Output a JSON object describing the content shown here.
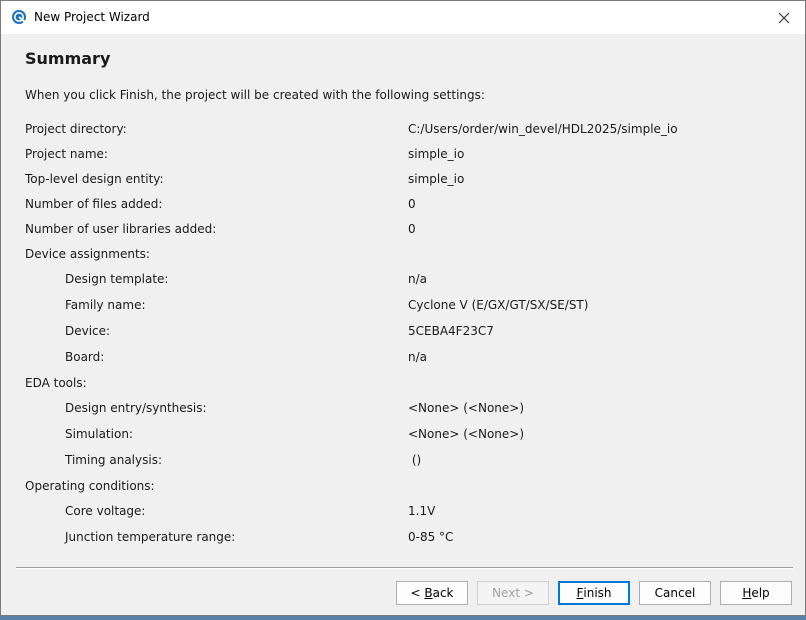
{
  "window": {
    "title": "New Project Wizard"
  },
  "page": {
    "heading": "Summary",
    "intro": "When you click Finish, the project will be created with the following settings:"
  },
  "settings": [
    {
      "label": "Project directory:",
      "value": "C:/Users/order/win_devel/HDL2025/simple_io",
      "level": 0
    },
    {
      "label": "Project name:",
      "value": "simple_io",
      "level": 0
    },
    {
      "label": "Top-level design entity:",
      "value": "simple_io",
      "level": 0
    },
    {
      "label": "Number of files added:",
      "value": "0",
      "level": 0
    },
    {
      "label": "Number of user libraries added:",
      "value": "0",
      "level": 0
    },
    {
      "label": "Device assignments:",
      "value": "",
      "level": 0
    },
    {
      "label": "Design template:",
      "value": "n/a",
      "level": 1
    },
    {
      "label": "Family name:",
      "value": "Cyclone V (E/GX/GT/SX/SE/ST)",
      "level": 1
    },
    {
      "label": "Device:",
      "value": "5CEBA4F23C7",
      "level": 1
    },
    {
      "label": "Board:",
      "value": "n/a",
      "level": 1
    },
    {
      "label": "EDA tools:",
      "value": "",
      "level": 0
    },
    {
      "label": "Design entry/synthesis:",
      "value": "<None> (<None>)",
      "level": 1
    },
    {
      "label": "Simulation:",
      "value": "<None> (<None>)",
      "level": 1
    },
    {
      "label": "Timing analysis:",
      "value": " ()",
      "level": 1
    },
    {
      "label": "Operating conditions:",
      "value": "",
      "level": 0
    },
    {
      "label": "Core voltage:",
      "value": "1.1V",
      "level": 1
    },
    {
      "label": "Junction temperature range:",
      "value": "0-85 °C",
      "level": 1
    }
  ],
  "buttons": {
    "back": {
      "prefix": "< ",
      "mnemonic": "B",
      "rest": "ack"
    },
    "next": {
      "label": "Next >"
    },
    "finish": {
      "mnemonic": "F",
      "rest": "inish"
    },
    "cancel": {
      "label": "Cancel"
    },
    "help": {
      "mnemonic": "H",
      "rest": "elp"
    }
  },
  "icons": {
    "app": "quartus-globe-icon",
    "close": "close-icon"
  }
}
